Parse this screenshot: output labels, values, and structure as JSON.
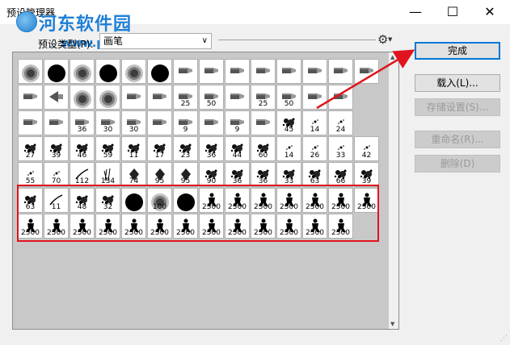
{
  "window": {
    "title": "预设管理器",
    "minimize": "—",
    "maximize": "☐",
    "close": "✕"
  },
  "watermark": {
    "text": "河东软件园",
    "url": "www.pc0359.cn"
  },
  "preset": {
    "label": "预设类型(P):",
    "value": "画笔"
  },
  "buttons": {
    "done": "完成",
    "load": "载入(L)...",
    "save": "存储设置(S)...",
    "rename": "重命名(R)...",
    "delete": "删除(D)"
  },
  "brushes": [
    [
      "",
      "",
      "",
      "",
      "",
      "",
      "",
      "",
      "",
      "",
      "",
      "",
      "",
      "",
      ""
    ],
    [
      "",
      "",
      "",
      "",
      "",
      "",
      "25",
      "50",
      "",
      "25",
      "50",
      "",
      "",
      "",
      ""
    ],
    [
      "",
      "",
      "36",
      "30",
      "30",
      "",
      "9",
      "",
      "9",
      "",
      "45",
      "14",
      "24",
      "",
      ""
    ],
    [
      "27",
      "39",
      "46",
      "59",
      "11",
      "17",
      "23",
      "36",
      "44",
      "60",
      "14",
      "26",
      "33",
      "42",
      ""
    ],
    [
      "55",
      "70",
      "112",
      "134",
      "74",
      "95",
      "95",
      "90",
      "36",
      "36",
      "33",
      "63",
      "66",
      "39",
      ""
    ],
    [
      "63",
      "11",
      "48",
      "32",
      "55",
      "100",
      "30",
      "2500",
      "2500",
      "2500",
      "2500",
      "2500",
      "2500",
      "2500",
      ""
    ],
    [
      "2500",
      "2500",
      "2500",
      "2500",
      "2500",
      "2500",
      "2500",
      "2500",
      "2500",
      "2500",
      "2500",
      "2500",
      "2500",
      "",
      ""
    ]
  ],
  "brush_kinds": [
    [
      "soft",
      "hard",
      "soft",
      "hard",
      "soft",
      "hard",
      "pencil",
      "tool",
      "tool",
      "tool",
      "tool",
      "tool",
      "tool",
      "tool",
      ""
    ],
    [
      "tool",
      "fan",
      "soft",
      "soft",
      "tool",
      "tool",
      "tool",
      "tool",
      "tool",
      "tool",
      "tool",
      "tool",
      "tool",
      "",
      ""
    ],
    [
      "tool",
      "tool",
      "tool",
      "tool",
      "tool",
      "tool",
      "tool",
      "tool",
      "tool",
      "tool",
      "splat",
      "dot",
      "dot",
      "",
      ""
    ],
    [
      "splat",
      "splat",
      "splat",
      "splat",
      "splat",
      "splat",
      "splat",
      "splat",
      "splat",
      "splat",
      "dot",
      "dot",
      "dot",
      "dot",
      ""
    ],
    [
      "dot",
      "dot",
      "stroke",
      "grass",
      "leaf",
      "leaf",
      "leaf",
      "splat",
      "splat",
      "splat",
      "splat",
      "splat",
      "splat",
      "splat",
      ""
    ],
    [
      "splat",
      "stroke",
      "splat",
      "splat",
      "hard",
      "soft",
      "hard",
      "figure",
      "figure",
      "figure",
      "figure",
      "figure",
      "figure",
      "figure",
      ""
    ],
    [
      "figure",
      "figure",
      "figure",
      "figure",
      "figure",
      "figure",
      "figure",
      "figure",
      "figure",
      "figure",
      "figure",
      "figure",
      "figure",
      "",
      ""
    ]
  ]
}
